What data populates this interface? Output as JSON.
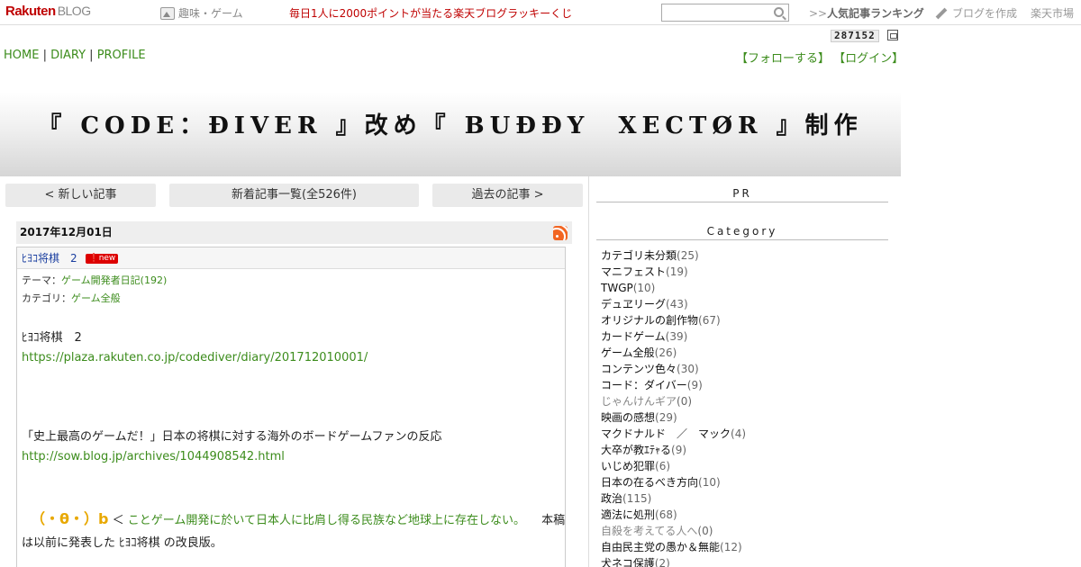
{
  "topbar": {
    "logo": "Rakuten",
    "logo_sub": "BLOG",
    "genre": "趣味・ゲーム",
    "lottery": "毎日1人に2000ポイントが当たる楽天ブログラッキーくじ",
    "search_value": "",
    "ranking_prefix": ">>",
    "ranking": "人気記事ランキング",
    "create_blog": "ブログを作成",
    "market": "楽天市場",
    "icons": [
      "image-icon",
      "search-icon",
      "pencil-icon"
    ]
  },
  "counter": "287152",
  "nav": {
    "home": "HOME",
    "diary": "DIARY",
    "profile": "PROFILE",
    "sep": "|"
  },
  "account": {
    "follow": "【フォローする】",
    "login": "【ログイン】"
  },
  "banner": {
    "title": "『 CODE：ĐIVER 』改め『 BUĐĐY　XECTØR 』制作"
  },
  "pager": {
    "newer": "< 新しい記事",
    "list": "新着記事一覧(全526件)",
    "older": "過去の記事 >"
  },
  "post": {
    "date": "2017年12月01日",
    "title": "ﾋﾖｺ将棋　2",
    "new_badge": "new",
    "theme_label": "テーマ：",
    "theme": "ゲーム開発者日記(192)",
    "category_label": "カテゴリ：",
    "category": "ゲーム全般",
    "line1": "ﾋﾖｺ将棋　2",
    "link1": "https://plaza.rakuten.co.jp/codediver/diary/201712010001/",
    "line2": "「史上最高のゲームだ！」日本の将棋に対する海外のボードゲームファンの反応",
    "link2": "http://sow.blog.jp/archives/1044908542.html",
    "face": "（・θ・）b",
    "lt": "＜",
    "quote": "ことゲーム開発に於いて日本人に比肩し得る民族など地球上に存在しない。",
    "tail1": "本稿",
    "tail2": "は以前に発表した ﾋﾖｺ将棋 の改良版。"
  },
  "sidebar": {
    "pr": "PR",
    "category_head": "Category",
    "categories": [
      {
        "name": "カテゴリ未分類",
        "count": "(25)"
      },
      {
        "name": "マニフェスト",
        "count": "(19)"
      },
      {
        "name": "TWGP",
        "count": "(10)"
      },
      {
        "name": "デュヱリーグ",
        "count": "(43)"
      },
      {
        "name": "オリジナルの創作物",
        "count": "(67)"
      },
      {
        "name": "カードゲーム",
        "count": "(39)"
      },
      {
        "name": "ゲーム全般",
        "count": "(26)"
      },
      {
        "name": "コンテンツ色々",
        "count": "(30)"
      },
      {
        "name": "コード：ダイバー",
        "count": "(9)"
      },
      {
        "name": "じゃんけんギア",
        "count": "(0)"
      },
      {
        "name": "映画の感想",
        "count": "(29)"
      },
      {
        "name": "マクドナルド　／　マック",
        "count": "(4)"
      },
      {
        "name": "大卒が教ｴﾃｬる",
        "count": "(9)"
      },
      {
        "name": "いじめ犯罪",
        "count": "(6)"
      },
      {
        "name": "日本の在るべき方向",
        "count": "(10)"
      },
      {
        "name": "政治",
        "count": "(115)"
      },
      {
        "name": "適法に処刑",
        "count": "(68)"
      },
      {
        "name": "自殺を考えてる人へ",
        "count": "(0)"
      },
      {
        "name": "自由民主党の愚か＆無能",
        "count": "(12)"
      },
      {
        "name": "犬ネコ保護",
        "count": "(2)"
      }
    ]
  }
}
